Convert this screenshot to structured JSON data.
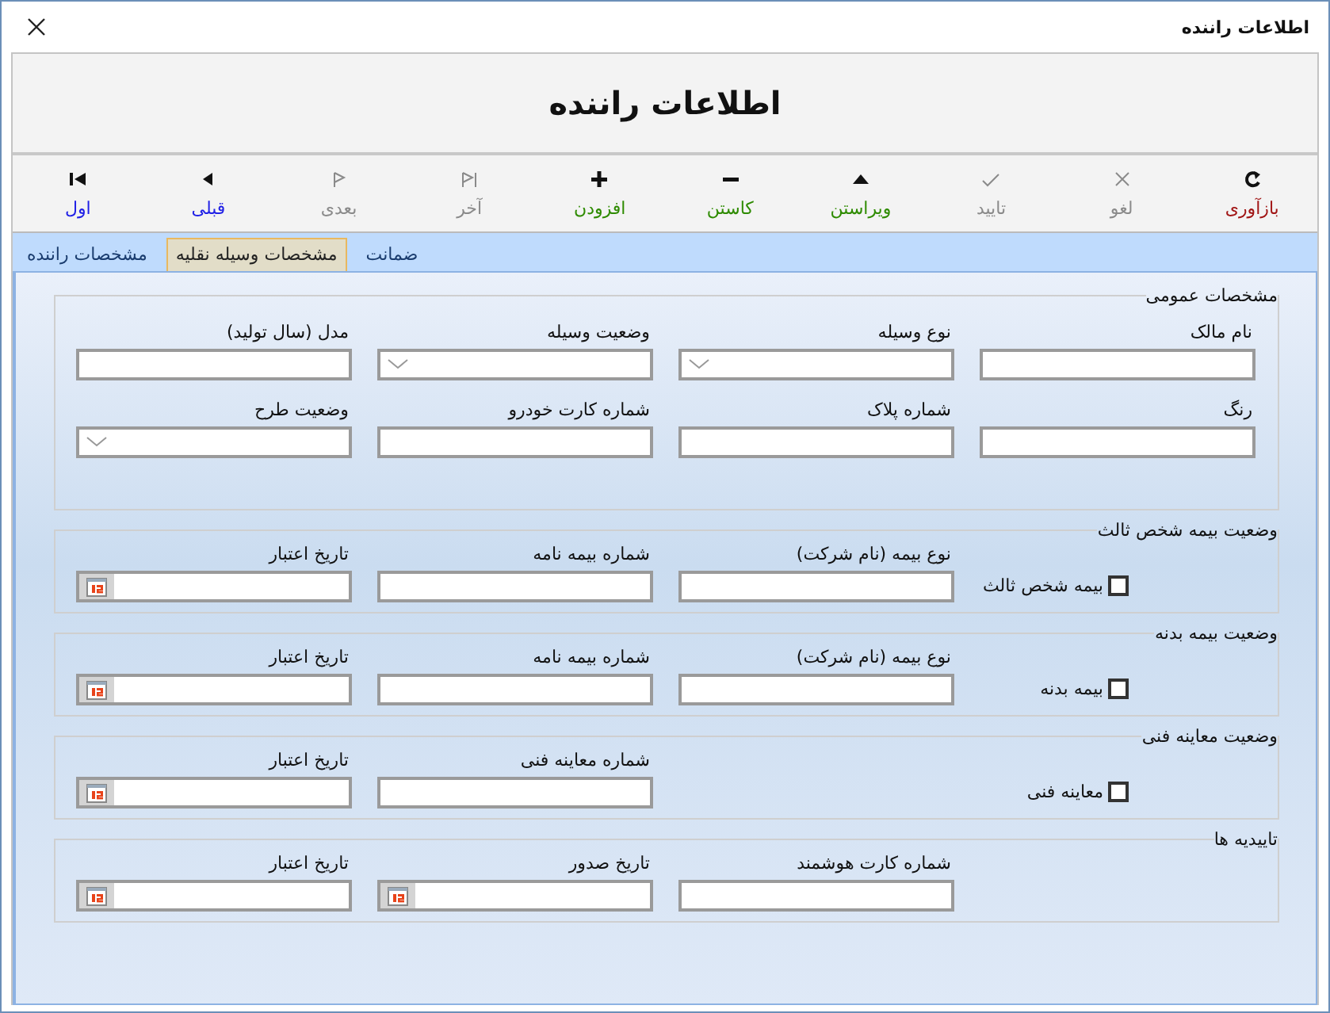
{
  "window": {
    "title": "اطلاعات راننده"
  },
  "header": {
    "title": "اطلاعات راننده"
  },
  "toolbar": [
    {
      "label": "بازآوری",
      "kind": "redo",
      "disabled": false,
      "color": "#a01414"
    },
    {
      "label": "لغو",
      "kind": "cancel",
      "disabled": true
    },
    {
      "label": "تایید",
      "kind": "check",
      "disabled": true
    },
    {
      "label": "ویراستن",
      "kind": "up",
      "disabled": false,
      "color": "#2e8b00"
    },
    {
      "label": "کاستن",
      "kind": "minus",
      "disabled": false,
      "color": "#2e8b00"
    },
    {
      "label": "افزودن",
      "kind": "plus",
      "disabled": false,
      "color": "#2e8b00"
    },
    {
      "label": "آخر",
      "kind": "last",
      "disabled": true
    },
    {
      "label": "بعدی",
      "kind": "next",
      "disabled": true
    },
    {
      "label": "قبلی",
      "kind": "prev",
      "disabled": false,
      "color": "#2020e6"
    },
    {
      "label": "اول",
      "kind": "first",
      "disabled": false,
      "color": "#2020e6"
    }
  ],
  "tabs": [
    {
      "label": "ضمانت",
      "selected": false
    },
    {
      "label": "مشخصات وسیله نقلیه",
      "selected": true
    },
    {
      "label": "مشخصات راننده",
      "selected": false
    }
  ],
  "groups": [
    {
      "title": "مشخصات عمومی",
      "kind": "fields",
      "fields": [
        {
          "label": "نام مالک",
          "kind": "text"
        },
        {
          "label": "نوع وسیله",
          "kind": "dropdown"
        },
        {
          "label": "وضعیت وسیله",
          "kind": "dropdown"
        },
        {
          "label": "مدل (سال تولید)",
          "kind": "text"
        },
        {
          "label": "رنگ",
          "kind": "text"
        },
        {
          "label": "شماره پلاک",
          "kind": "text"
        },
        {
          "label": "شماره کارت خودرو",
          "kind": "text"
        },
        {
          "label": "وضعیت طرح",
          "kind": "dropdown"
        }
      ]
    },
    {
      "title": "وضعیت بیمه شخص ثالث",
      "kind": "status",
      "checkbox": {
        "label": "بیمه شخص ثالث",
        "checked": false
      },
      "fields": [
        {
          "label": "نوع بیمه (نام شرکت)",
          "kind": "text"
        },
        {
          "label": "شماره بیمه نامه",
          "kind": "text"
        },
        {
          "label": "تاریخ اعتبار",
          "kind": "date"
        }
      ]
    },
    {
      "title": "وضعیت بیمه بدنه",
      "kind": "status",
      "checkbox": {
        "label": "بیمه بدنه",
        "checked": false
      },
      "fields": [
        {
          "label": "نوع بیمه (نام شرکت)",
          "kind": "text"
        },
        {
          "label": "شماره بیمه نامه",
          "kind": "text"
        },
        {
          "label": "تاریخ اعتبار",
          "kind": "date"
        }
      ]
    },
    {
      "title": "وضعیت معاینه فنی",
      "kind": "status",
      "checkbox": {
        "label": "معاینه فنی",
        "checked": false
      },
      "fields": [
        {
          "kind": "none"
        },
        {
          "label": "شماره معاینه فنی",
          "kind": "text"
        },
        {
          "label": "تاریخ اعتبار",
          "kind": "date"
        }
      ]
    },
    {
      "title": "تاییدیه ها",
      "kind": "status",
      "fields": [
        {
          "label": "شماره کارت هوشمند",
          "kind": "text"
        },
        {
          "label": "تاریخ صدور",
          "kind": "date"
        },
        {
          "label": "تاریخ اعتبار",
          "kind": "date"
        }
      ]
    }
  ]
}
